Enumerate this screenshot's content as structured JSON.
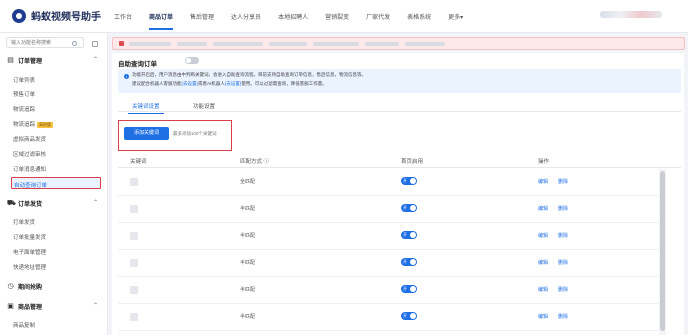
{
  "app": {
    "title": "蚂蚁视频号助手"
  },
  "nav": [
    {
      "label": "工作台",
      "active": false
    },
    {
      "label": "商品订单",
      "active": true
    },
    {
      "label": "售后管理",
      "active": false
    },
    {
      "label": "达人分享员",
      "active": false
    },
    {
      "label": "本地招聘人",
      "active": false
    },
    {
      "label": "营销裂变",
      "active": false
    },
    {
      "label": "厂家代发",
      "active": false
    },
    {
      "label": "表格系统",
      "active": false
    },
    {
      "label": "更多▾",
      "active": false
    }
  ],
  "sidebar": {
    "search_placeholder": "输入功能名称搜索",
    "groups": [
      {
        "label": "订单管理",
        "icon": "cart-icon",
        "items": [
          {
            "label": "订单列表"
          },
          {
            "label": "预售订单"
          },
          {
            "label": "物流追踪"
          },
          {
            "label": "物流追踪",
            "tag": "高阶版"
          },
          {
            "label": "虚拟商品发货"
          },
          {
            "label": "区域过滤审核"
          },
          {
            "label": "订单消息通知"
          },
          {
            "label": "自动查询订单",
            "selected": true
          }
        ]
      },
      {
        "label": "订单发货",
        "icon": "truck-icon",
        "items": [
          {
            "label": "打单发货"
          },
          {
            "label": "订单批量发货"
          },
          {
            "label": "电子面单管理"
          },
          {
            "label": "快递地址管理"
          }
        ]
      },
      {
        "label": "期间抢购",
        "icon": "clock-icon",
        "items": []
      },
      {
        "label": "商品管理",
        "icon": "box-icon",
        "items": [
          {
            "label": "商品复制"
          }
        ]
      }
    ]
  },
  "section": {
    "title": "自助查询订单",
    "toggle_on": false,
    "info_lines": [
      "功能开启后，用户消息由中判断关键词，会进入自助查询流程。目前支持自助查询订单信息，售后信息，物流信息等。",
      "建议配合机器人客服功能",
      "使用。",
      "可以过滤需查询，降低客服工作量。"
    ],
    "info_links": [
      "(去设置)",
      "或者AI机器人",
      "(去设置)"
    ],
    "tabs": [
      {
        "label": "关键词设置",
        "active": true
      },
      {
        "label": "功能设置",
        "active": false
      }
    ],
    "add_button": "添加关键词",
    "add_hint": "最多添加100个关键词"
  },
  "table": {
    "headers": {
      "keyword": "关键词",
      "match": "匹配方式 ⓘ",
      "first_use": "首页启用",
      "actions": "操作"
    },
    "rows": [
      {
        "match": "全匹配",
        "enabled": true,
        "switch_label": "开",
        "edit": "编辑",
        "delete": "删除"
      },
      {
        "match": "半匹配",
        "enabled": true,
        "switch_label": "开",
        "edit": "编辑",
        "delete": "删除"
      },
      {
        "match": "半匹配",
        "enabled": true,
        "switch_label": "开",
        "edit": "编辑",
        "delete": "删除"
      },
      {
        "match": "半匹配",
        "enabled": true,
        "switch_label": "开",
        "edit": "编辑",
        "delete": "删除"
      },
      {
        "match": "半匹配",
        "enabled": true,
        "switch_label": "开",
        "edit": "编辑",
        "delete": "删除"
      },
      {
        "match": "半匹配",
        "enabled": true,
        "switch_label": "开",
        "edit": "编辑",
        "delete": "删除"
      }
    ]
  },
  "colors": {
    "accent": "#1f6fe5",
    "highlight": "#d9404a",
    "alert_bg": "#fde9ea"
  }
}
